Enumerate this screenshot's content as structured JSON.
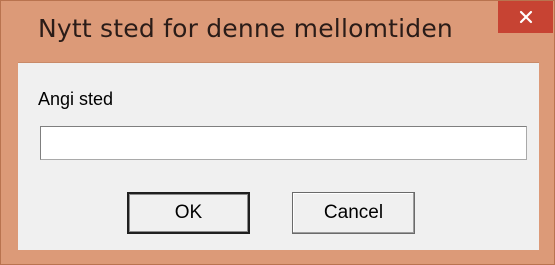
{
  "window": {
    "title": "Nytt sted for denne mellomtiden",
    "close_icon": "close-icon"
  },
  "form": {
    "label": "Angi sted",
    "input_value": ""
  },
  "buttons": {
    "ok_label": "OK",
    "cancel_label": "Cancel"
  },
  "colors": {
    "frame": "#dc9a78",
    "close_button": "#c74333",
    "client_background": "#f0f0f0"
  }
}
